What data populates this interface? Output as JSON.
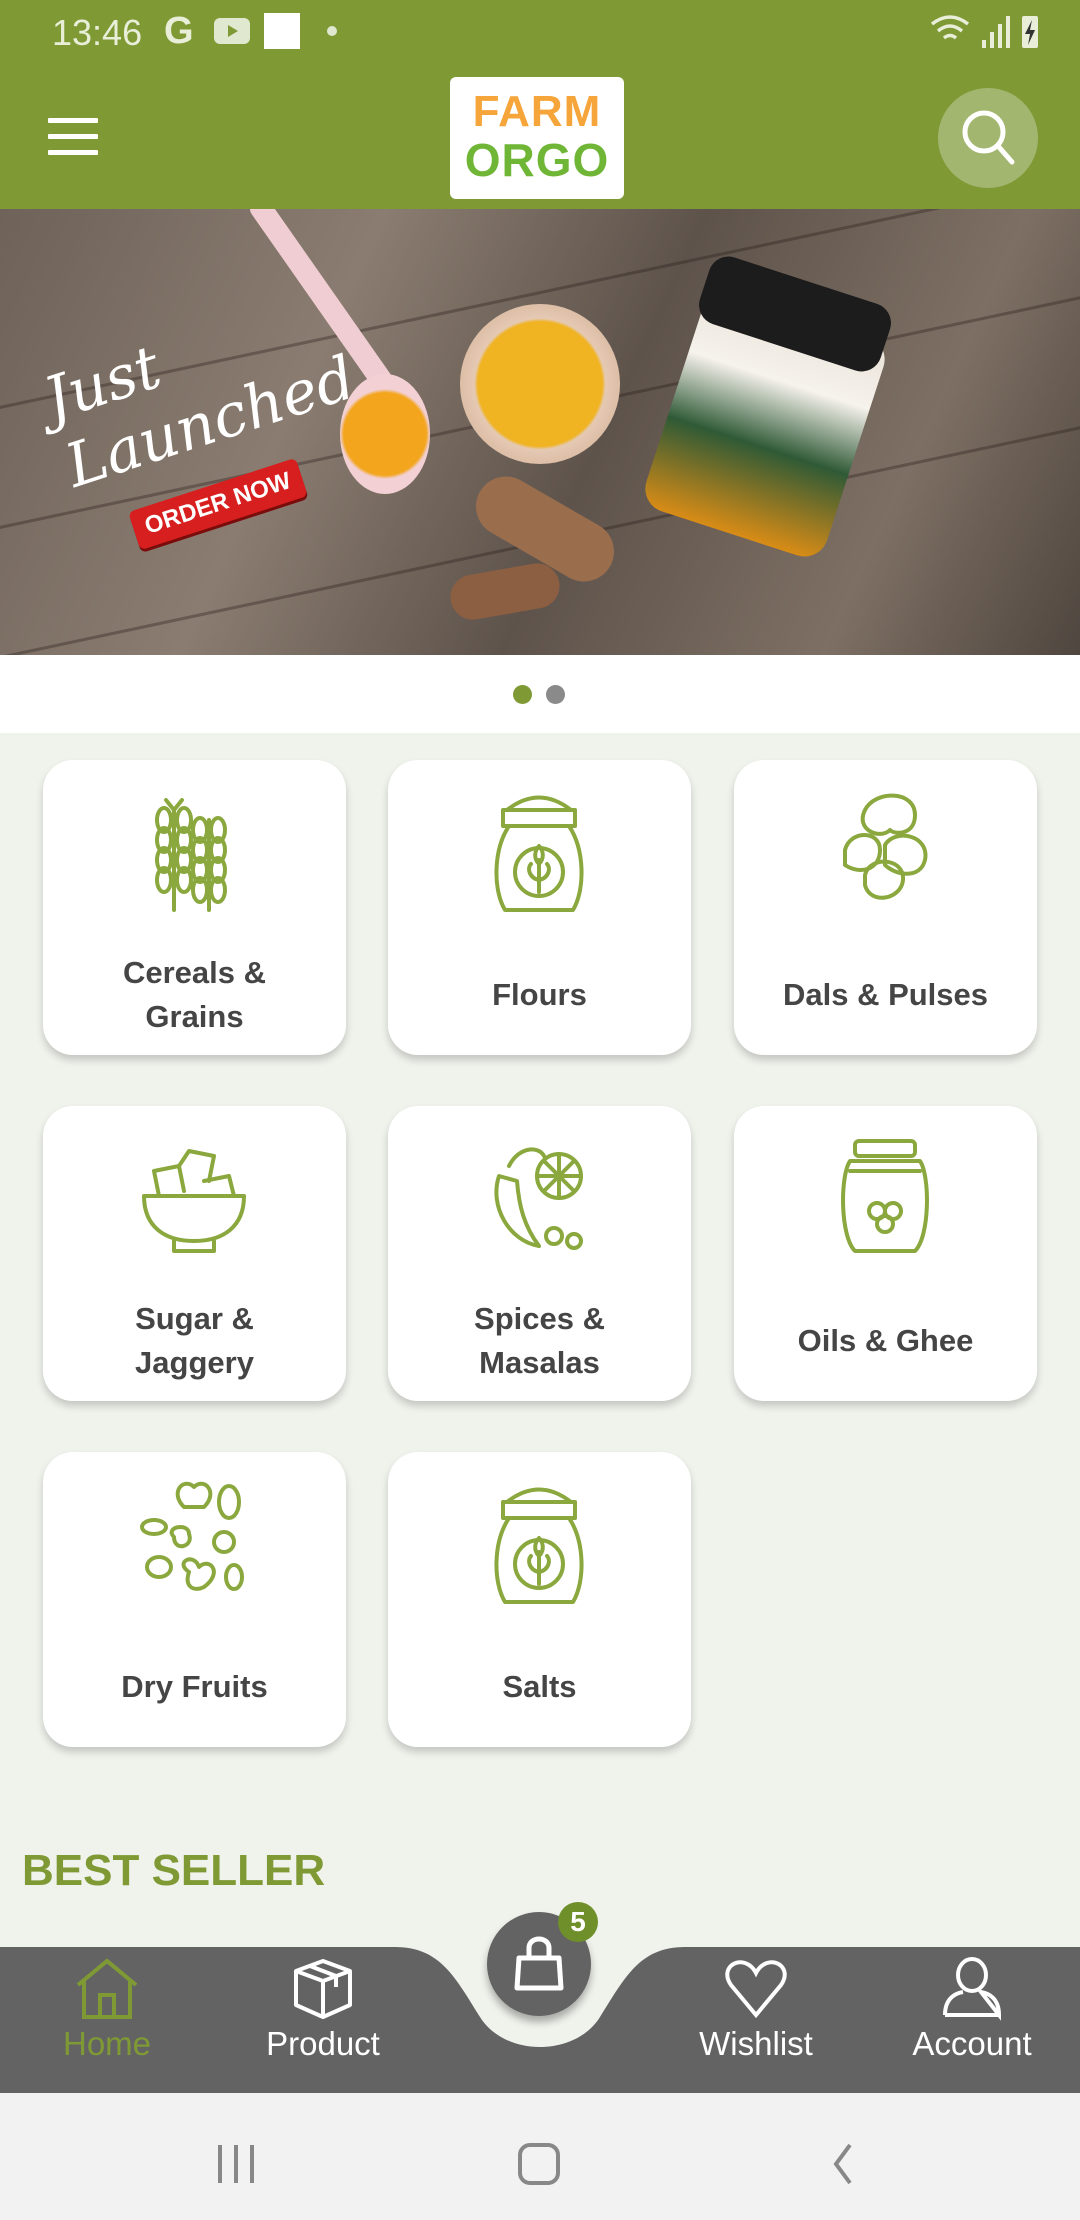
{
  "status_bar": {
    "time": "13:46",
    "g_label": "G"
  },
  "header": {
    "logo_line1": "FARM",
    "logo_line2": "ORGO"
  },
  "banner": {
    "script_text": "Just\nLaunched",
    "cta": "ORDER NOW",
    "slides": 2,
    "active_slide": 0
  },
  "categories": [
    {
      "label": "Cereals & Grains",
      "icon": "wheat-icon"
    },
    {
      "label": "Flours",
      "icon": "flour-sack-icon"
    },
    {
      "label": "Dals & Pulses",
      "icon": "beans-icon"
    },
    {
      "label": "Sugar & Jaggery",
      "icon": "sugar-bowl-icon"
    },
    {
      "label": "Spices & Masalas",
      "icon": "spices-icon"
    },
    {
      "label": "Oils & Ghee",
      "icon": "ghee-jar-icon"
    },
    {
      "label": "Dry Fruits",
      "icon": "dry-fruits-icon"
    },
    {
      "label": "Salts",
      "icon": "salt-sack-icon"
    }
  ],
  "section_title": "BEST SELLER",
  "bottom_nav": {
    "items": [
      {
        "label": "Home",
        "icon": "home-icon",
        "active": true
      },
      {
        "label": "Product",
        "icon": "box-icon"
      },
      {
        "label": "Wishlist",
        "icon": "heart-icon"
      },
      {
        "label": "Account",
        "icon": "user-icon"
      }
    ],
    "cart_count": "5"
  },
  "colors": {
    "brand": "#7f9a35",
    "icon": "#8aa83e",
    "nav": "#636363",
    "text": "#454545"
  }
}
